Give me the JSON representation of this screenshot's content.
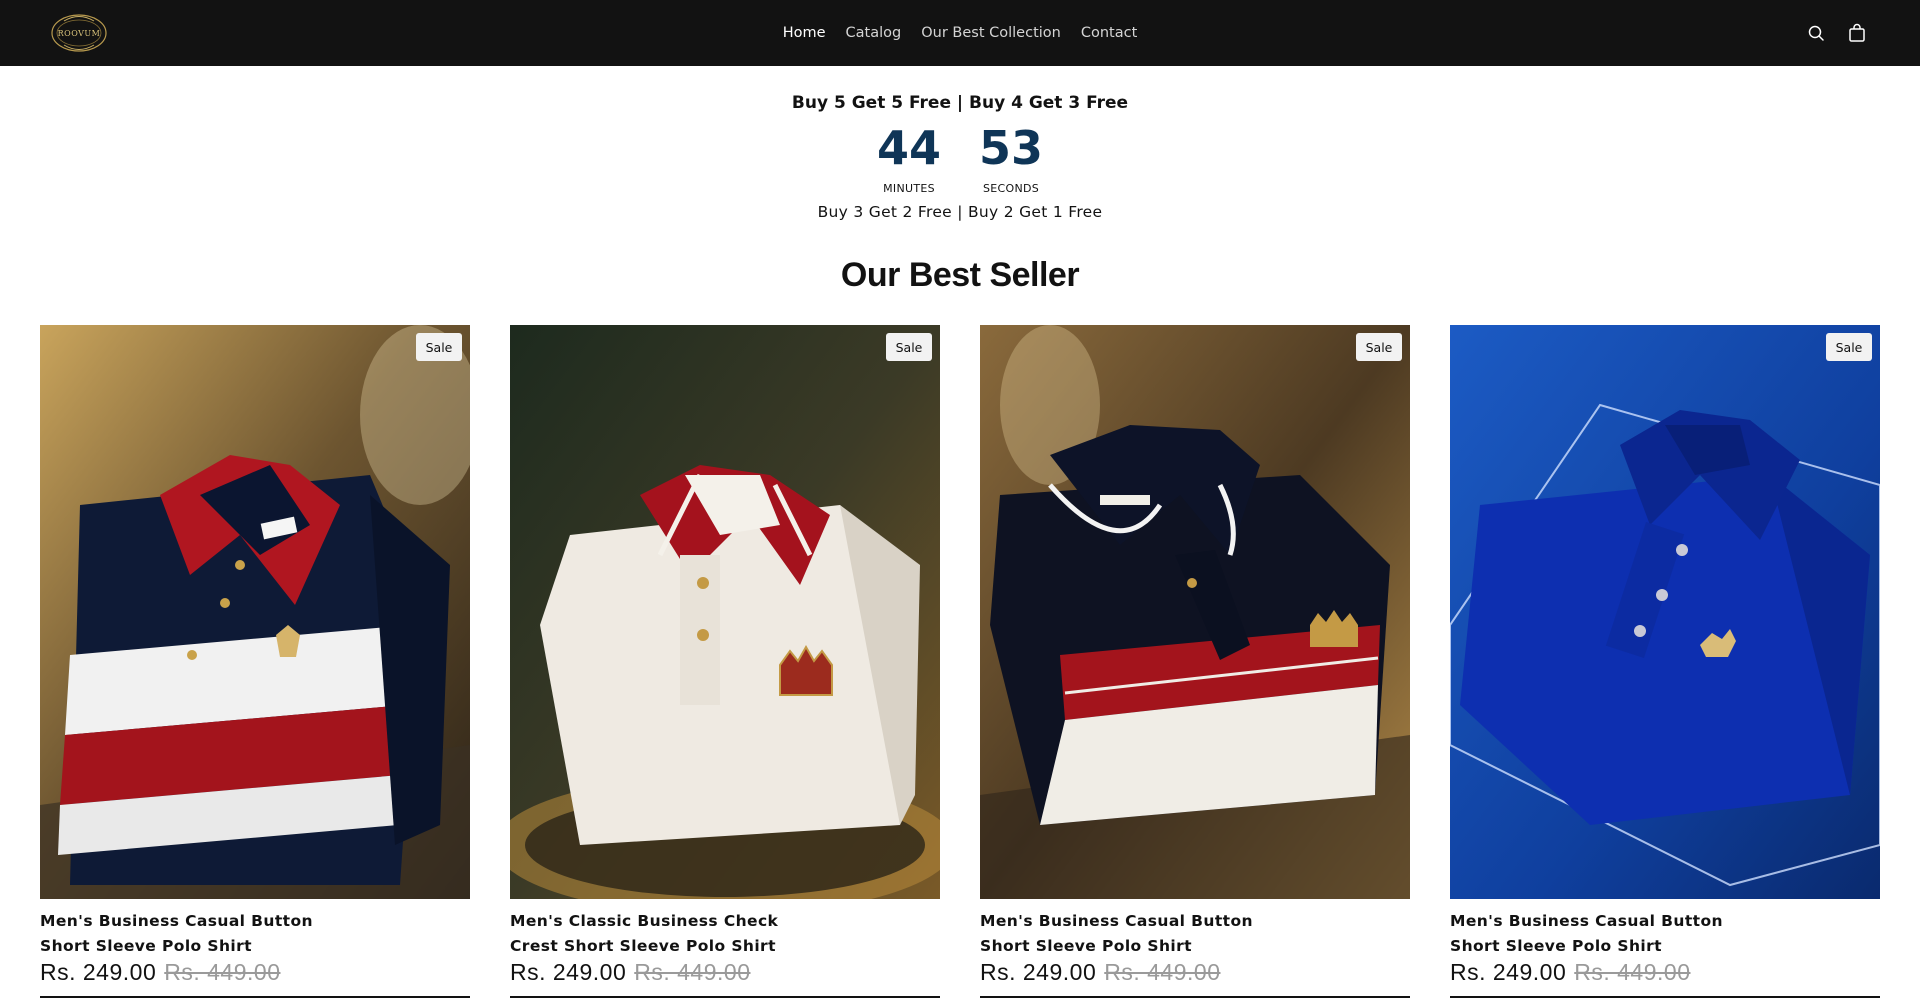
{
  "header": {
    "logo_text": "ROOVUM",
    "nav": [
      {
        "label": "Home",
        "active": true
      },
      {
        "label": "Catalog",
        "active": false
      },
      {
        "label": "Our Best Collection",
        "active": false
      },
      {
        "label": "Contact",
        "active": false
      }
    ],
    "icons": {
      "search": "search-icon",
      "cart": "cart-icon"
    }
  },
  "promo": {
    "headline": "Buy 5 Get 5 Free | Buy 4 Get 3 Free",
    "countdown": {
      "minutes": {
        "value": "44",
        "label": "MINUTES"
      },
      "seconds": {
        "value": "53",
        "label": "SECONDS"
      }
    },
    "subline": "Buy 3 Get 2 Free | Buy 2 Get 1 Free"
  },
  "section": {
    "title": "Our Best Seller"
  },
  "products": [
    {
      "title_line1": "Men's Business Casual Button",
      "title_line2": "Short Sleeve Polo Shirt",
      "badge": "Sale",
      "price_sale": "Rs. 249.00",
      "price_regular": "Rs. 449.00"
    },
    {
      "title_line1": "Men's Classic Business Check",
      "title_line2": "Crest Short Sleeve Polo Shirt",
      "badge": "Sale",
      "price_sale": "Rs. 249.00",
      "price_regular": "Rs. 449.00"
    },
    {
      "title_line1": "Men's Business Casual Button",
      "title_line2": "Short Sleeve Polo Shirt",
      "badge": "Sale",
      "price_sale": "Rs. 249.00",
      "price_regular": "Rs. 449.00"
    },
    {
      "title_line1": "Men's Business Casual Button",
      "title_line2": "Short Sleeve Polo Shirt",
      "badge": "Sale",
      "price_sale": "Rs. 249.00",
      "price_regular": "Rs. 449.00"
    }
  ],
  "colors": {
    "header_bg": "#121212",
    "countdown": "#0f3557",
    "text": "#121212",
    "muted_price": "#9a9a9a"
  }
}
